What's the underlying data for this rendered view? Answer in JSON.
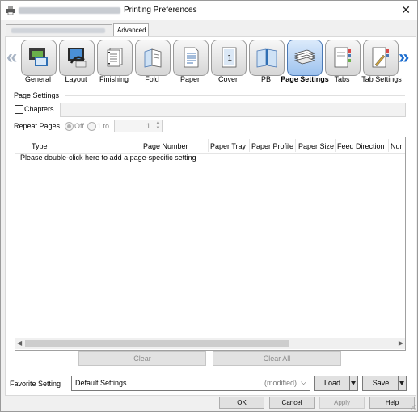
{
  "window": {
    "title": "Printing Preferences"
  },
  "tabs": {
    "active_label": "Advanced"
  },
  "toolbar": {
    "items": [
      {
        "label": "General",
        "icon": "printer-photo-icon"
      },
      {
        "label": "Layout",
        "icon": "layout-monitor-icon"
      },
      {
        "label": "Finishing",
        "icon": "stapled-pages-icon"
      },
      {
        "label": "Fold",
        "icon": "folded-paper-icon"
      },
      {
        "label": "Paper",
        "icon": "paper-sheet-icon"
      },
      {
        "label": "Cover",
        "icon": "cover-page-icon"
      },
      {
        "label": "PB",
        "icon": "perfect-binding-icon"
      },
      {
        "label": "Page Settings",
        "icon": "page-stack-icon",
        "active": true
      },
      {
        "label": "Tabs",
        "icon": "tab-paper-icon"
      },
      {
        "label": "Tab Settings",
        "icon": "tab-settings-icon"
      }
    ]
  },
  "page_settings": {
    "group_title": "Page Settings",
    "chapters_label": "Chapters",
    "repeat_label": "Repeat Pages",
    "radio_off": "Off",
    "radio_1to": "1 to",
    "repeat_value": "1"
  },
  "table": {
    "columns": [
      "Type",
      "Page Number",
      "Paper Tray",
      "Paper Profile",
      "Paper Size",
      "Feed Direction",
      "Nur"
    ],
    "hint": "Please double-click here to add a page-specific setting"
  },
  "actions": {
    "clear": "Clear",
    "clear_all": "Clear All"
  },
  "favorite": {
    "label": "Favorite Setting",
    "value": "Default Settings",
    "modified": "(modified)",
    "load": "Load",
    "save": "Save"
  },
  "buttons": {
    "ok": "OK",
    "cancel": "Cancel",
    "apply": "Apply",
    "help": "Help"
  },
  "colors": {
    "accent": "#1f6fcf",
    "active_tile": "#9dc2ee",
    "disabled_text": "#8a8a8a"
  }
}
